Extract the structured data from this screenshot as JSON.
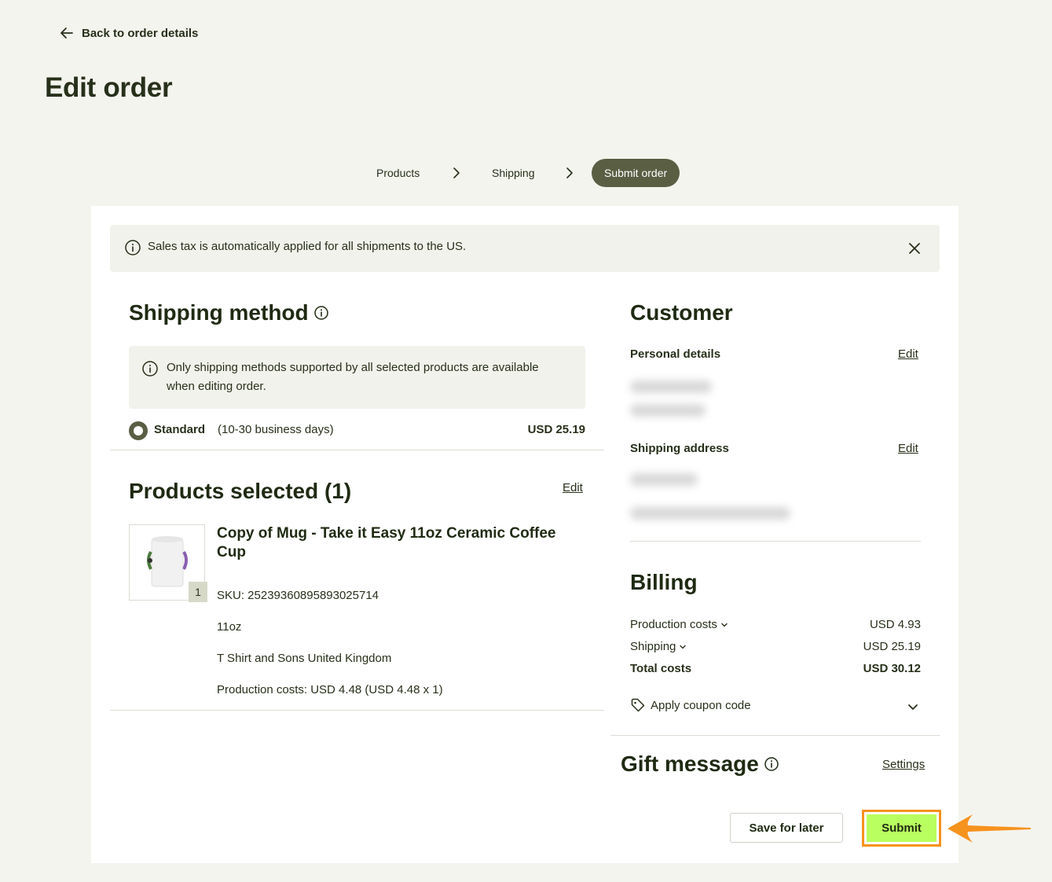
{
  "nav": {
    "back_label": "Back to order details"
  },
  "page": {
    "title": "Edit order"
  },
  "stepper": {
    "steps": [
      {
        "label": "Products"
      },
      {
        "label": "Shipping"
      },
      {
        "label": "Submit order"
      }
    ]
  },
  "banner": {
    "text": "Sales tax is automatically applied for all shipments to the US."
  },
  "shipping_method": {
    "title": "Shipping method",
    "notice_line1": "Only shipping methods supported by all selected products are available",
    "notice_line2": "when editing order.",
    "option_name": "Standard",
    "option_days": "(10-30 business days)",
    "option_price": "USD 25.19"
  },
  "products": {
    "title": "Products selected (1)",
    "edit_label": "Edit",
    "item": {
      "title_line1": "Copy of Mug - Take it Easy 11oz Ceramic Coffee",
      "title_line2": "Cup",
      "quantity": "1",
      "sku": "SKU: 25239360895893025714",
      "size": "11oz",
      "provider": "T Shirt and Sons United Kingdom",
      "production_costs": "Production costs: USD 4.48 (USD 4.48 x 1)"
    }
  },
  "customer": {
    "title": "Customer",
    "personal_details_label": "Personal details",
    "personal_edit_label": "Edit",
    "shipping_address_label": "Shipping address",
    "address_edit_label": "Edit"
  },
  "billing": {
    "title": "Billing",
    "production_label": "Production costs",
    "production_value": "USD 4.93",
    "shipping_label": "Shipping",
    "shipping_value": "USD 25.19",
    "total_label": "Total costs",
    "total_value": "USD 30.12",
    "coupon_label": "Apply coupon code"
  },
  "gift": {
    "title": "Gift message",
    "settings_label": "Settings"
  },
  "actions": {
    "save_label": "Save for later",
    "submit_label": "Submit"
  },
  "colors": {
    "background": "#f4f4ee",
    "text": "#27301a",
    "step_active": "#5a5e43",
    "submit": "#b9ff5f",
    "highlight": "#f6921e"
  }
}
